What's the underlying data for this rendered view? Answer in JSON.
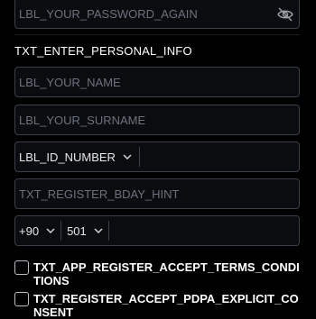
{
  "password_again": {
    "placeholder": "LBL_YOUR_PASSWORD_AGAIN",
    "toggle_icon": "eye-off-icon"
  },
  "section_title": "TXT_ENTER_PERSONAL_INFO",
  "name": {
    "placeholder": "LBL_YOUR_NAME"
  },
  "surname": {
    "placeholder": "LBL_YOUR_SURNAME"
  },
  "id_number": {
    "type_label": "LBL_ID_NUMBER",
    "icon": "chevron-down-icon"
  },
  "birthday": {
    "placeholder": "TXT_REGISTER_BDAY_HINT"
  },
  "phone": {
    "country_code": "+90",
    "operator_code": "501",
    "icon": "chevron-down-icon"
  },
  "checkboxes": [
    {
      "label": "TXT_APP_REGISTER_ACCEPT_TERMS_CONDITIONS",
      "checked": false
    },
    {
      "label": "TXT_REGISTER_ACCEPT_PDPA_EXPLICIT_CONSENT",
      "checked": false
    }
  ],
  "colors": {
    "background": "#000000",
    "border": "#3a3f4a",
    "placeholder": "#6c727d"
  }
}
